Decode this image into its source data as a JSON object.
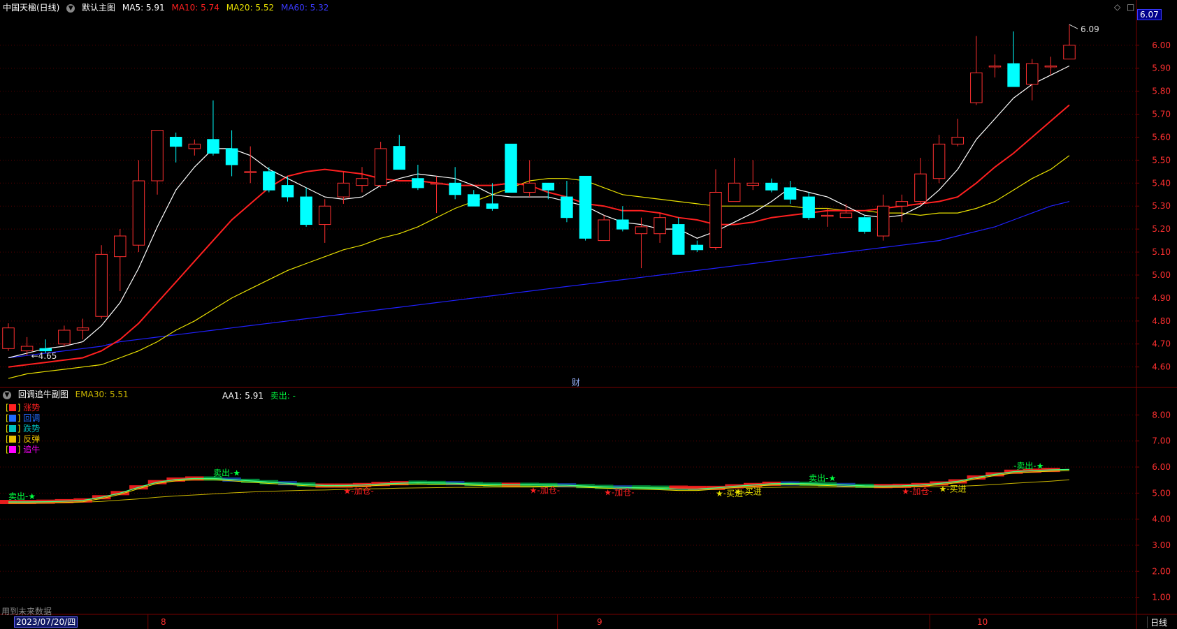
{
  "main_panel": {
    "stock_name": "中国天楹(日线)",
    "template": "默认主图",
    "ma_labels": [
      {
        "text": "MA5: 5.91",
        "color": "#ffffff"
      },
      {
        "text": "MA10: 5.74",
        "color": "#ff2020"
      },
      {
        "text": "MA20: 5.52",
        "color": "#e8e000"
      },
      {
        "text": "MA60: 5.32",
        "color": "#2020ff"
      }
    ],
    "current_price_tag": "6.07",
    "high_annotation": "6.09",
    "low_annotation": "4.65",
    "finance_marker": "财"
  },
  "sub_panel": {
    "title": "回调追牛副图",
    "ema_label": "EMA30: 5.51",
    "aa1_label": "AA1: 5.91",
    "sell_label": "卖出: -",
    "legend": [
      {
        "label": "涨势",
        "color": "#ff2020"
      },
      {
        "label": "回调",
        "color": "#1e6bff"
      },
      {
        "label": "跌势",
        "color": "#00c0c0"
      },
      {
        "label": "反弹",
        "color": "#e8c000"
      },
      {
        "label": "追牛",
        "color": "#ff00ff"
      }
    ],
    "signals": [
      {
        "text": "卖出-★",
        "color": "#00ff40",
        "idx": 0
      },
      {
        "text": "卖出-★",
        "color": "#00ff40",
        "idx": 11
      },
      {
        "text": "★-加仓-",
        "color": "#ff2020",
        "idx": 18
      },
      {
        "text": "★-加仓-",
        "color": "#ff2020",
        "idx": 28
      },
      {
        "text": "★-加仓-",
        "color": "#ff2020",
        "idx": 32
      },
      {
        "text": "★-买进-",
        "color": "#e8e000",
        "idx": 38
      },
      {
        "text": "★-买进",
        "color": "#e8e000",
        "idx": 39
      },
      {
        "text": "卖出-★",
        "color": "#00ff40",
        "idx": 43
      },
      {
        "text": "★-加仓-",
        "color": "#ff2020",
        "idx": 48
      },
      {
        "text": "★-买进",
        "color": "#e8e000",
        "idx": 50
      },
      {
        "text": "-卖出-★",
        "color": "#00ff40",
        "idx": 54
      }
    ]
  },
  "bottom_bar": {
    "future_data_note": "用到未来数据",
    "date_box": "2023/07/20/四",
    "month_labels": [
      "8",
      "9",
      "10"
    ],
    "period_button": "日线"
  },
  "icons": [
    "diamond-icon",
    "square-icon",
    "collapse-triangle-icon"
  ],
  "chart_data": [
    {
      "type": "candlestick",
      "title": "中国天楹(日线)",
      "y_axis_ticks": [
        4.6,
        4.7,
        4.8,
        4.9,
        5.0,
        5.1,
        5.2,
        5.3,
        5.4,
        5.5,
        5.6,
        5.7,
        5.8,
        5.9,
        6.0
      ],
      "ylim": [
        4.52,
        6.13
      ],
      "candles": [
        {
          "o": 4.68,
          "h": 4.79,
          "l": 4.67,
          "c": 4.77
        },
        {
          "o": 4.67,
          "h": 4.73,
          "l": 4.65,
          "c": 4.69
        },
        {
          "o": 4.68,
          "h": 4.72,
          "l": 4.66,
          "c": 4.67
        },
        {
          "o": 4.7,
          "h": 4.78,
          "l": 4.69,
          "c": 4.76
        },
        {
          "o": 4.76,
          "h": 4.81,
          "l": 4.72,
          "c": 4.77
        },
        {
          "o": 4.82,
          "h": 5.13,
          "l": 4.81,
          "c": 5.09
        },
        {
          "o": 5.08,
          "h": 5.2,
          "l": 4.93,
          "c": 5.17
        },
        {
          "o": 5.13,
          "h": 5.5,
          "l": 5.1,
          "c": 5.41
        },
        {
          "o": 5.41,
          "h": 5.63,
          "l": 5.35,
          "c": 5.63
        },
        {
          "o": 5.6,
          "h": 5.62,
          "l": 5.49,
          "c": 5.56
        },
        {
          "o": 5.55,
          "h": 5.59,
          "l": 5.52,
          "c": 5.57
        },
        {
          "o": 5.59,
          "h": 5.76,
          "l": 5.52,
          "c": 5.53
        },
        {
          "o": 5.55,
          "h": 5.63,
          "l": 5.43,
          "c": 5.48
        },
        {
          "o": 5.45,
          "h": 5.56,
          "l": 5.4,
          "c": 5.45
        },
        {
          "o": 5.45,
          "h": 5.47,
          "l": 5.36,
          "c": 5.37
        },
        {
          "o": 5.39,
          "h": 5.43,
          "l": 5.32,
          "c": 5.34
        },
        {
          "o": 5.34,
          "h": 5.38,
          "l": 5.21,
          "c": 5.22
        },
        {
          "o": 5.22,
          "h": 5.33,
          "l": 5.14,
          "c": 5.3
        },
        {
          "o": 5.34,
          "h": 5.45,
          "l": 5.31,
          "c": 5.4
        },
        {
          "o": 5.39,
          "h": 5.47,
          "l": 5.36,
          "c": 5.42
        },
        {
          "o": 5.39,
          "h": 5.58,
          "l": 5.38,
          "c": 5.55
        },
        {
          "o": 5.56,
          "h": 5.61,
          "l": 5.46,
          "c": 5.46
        },
        {
          "o": 5.42,
          "h": 5.48,
          "l": 5.37,
          "c": 5.38
        },
        {
          "o": 5.4,
          "h": 5.43,
          "l": 5.27,
          "c": 5.4
        },
        {
          "o": 5.4,
          "h": 5.47,
          "l": 5.33,
          "c": 5.35
        },
        {
          "o": 5.35,
          "h": 5.37,
          "l": 5.3,
          "c": 5.3
        },
        {
          "o": 5.31,
          "h": 5.4,
          "l": 5.28,
          "c": 5.29
        },
        {
          "o": 5.57,
          "h": 5.57,
          "l": 5.36,
          "c": 5.36
        },
        {
          "o": 5.36,
          "h": 5.5,
          "l": 5.34,
          "c": 5.4
        },
        {
          "o": 5.4,
          "h": 5.38,
          "l": 5.33,
          "c": 5.37
        },
        {
          "o": 5.34,
          "h": 5.41,
          "l": 5.23,
          "c": 5.25
        },
        {
          "o": 5.43,
          "h": 5.43,
          "l": 5.15,
          "c": 5.16
        },
        {
          "o": 5.15,
          "h": 5.26,
          "l": 5.15,
          "c": 5.24
        },
        {
          "o": 5.24,
          "h": 5.3,
          "l": 5.19,
          "c": 5.2
        },
        {
          "o": 5.18,
          "h": 5.25,
          "l": 5.03,
          "c": 5.21
        },
        {
          "o": 5.18,
          "h": 5.27,
          "l": 5.14,
          "c": 5.25
        },
        {
          "o": 5.22,
          "h": 5.25,
          "l": 5.09,
          "c": 5.09
        },
        {
          "o": 5.13,
          "h": 5.15,
          "l": 5.1,
          "c": 5.11
        },
        {
          "o": 5.12,
          "h": 5.46,
          "l": 5.11,
          "c": 5.36
        },
        {
          "o": 5.32,
          "h": 5.51,
          "l": 5.32,
          "c": 5.4
        },
        {
          "o": 5.39,
          "h": 5.5,
          "l": 5.37,
          "c": 5.4
        },
        {
          "o": 5.4,
          "h": 5.42,
          "l": 5.36,
          "c": 5.37
        },
        {
          "o": 5.38,
          "h": 5.41,
          "l": 5.31,
          "c": 5.33
        },
        {
          "o": 5.34,
          "h": 5.36,
          "l": 5.24,
          "c": 5.25
        },
        {
          "o": 5.26,
          "h": 5.29,
          "l": 5.21,
          "c": 5.26
        },
        {
          "o": 5.25,
          "h": 5.31,
          "l": 5.25,
          "c": 5.27
        },
        {
          "o": 5.25,
          "h": 5.26,
          "l": 5.18,
          "c": 5.19
        },
        {
          "o": 5.17,
          "h": 5.35,
          "l": 5.15,
          "c": 5.3
        },
        {
          "o": 5.3,
          "h": 5.35,
          "l": 5.23,
          "c": 5.32
        },
        {
          "o": 5.32,
          "h": 5.51,
          "l": 5.31,
          "c": 5.44
        },
        {
          "o": 5.42,
          "h": 5.61,
          "l": 5.4,
          "c": 5.57
        },
        {
          "o": 5.57,
          "h": 5.68,
          "l": 5.56,
          "c": 5.6
        },
        {
          "o": 5.75,
          "h": 6.04,
          "l": 5.74,
          "c": 5.88
        },
        {
          "o": 5.91,
          "h": 5.96,
          "l": 5.86,
          "c": 5.91
        },
        {
          "o": 5.92,
          "h": 6.06,
          "l": 5.82,
          "c": 5.82
        },
        {
          "o": 5.83,
          "h": 5.94,
          "l": 5.76,
          "c": 5.92
        },
        {
          "o": 5.91,
          "h": 5.95,
          "l": 5.87,
          "c": 5.91
        },
        {
          "o": 5.94,
          "h": 6.09,
          "l": 5.94,
          "c": 6.0
        }
      ],
      "ma5": [
        4.64,
        4.66,
        4.68,
        4.69,
        4.71,
        4.78,
        4.88,
        5.03,
        5.21,
        5.37,
        5.47,
        5.55,
        5.55,
        5.52,
        5.46,
        5.42,
        5.38,
        5.34,
        5.33,
        5.34,
        5.39,
        5.42,
        5.44,
        5.43,
        5.42,
        5.39,
        5.35,
        5.34,
        5.34,
        5.34,
        5.32,
        5.3,
        5.26,
        5.23,
        5.22,
        5.2,
        5.2,
        5.16,
        5.19,
        5.23,
        5.27,
        5.32,
        5.38,
        5.36,
        5.34,
        5.3,
        5.26,
        5.25,
        5.26,
        5.3,
        5.37,
        5.46,
        5.59,
        5.68,
        5.77,
        5.83,
        5.87,
        5.91
      ],
      "ma10": [
        4.6,
        4.61,
        4.62,
        4.63,
        4.64,
        4.67,
        4.72,
        4.79,
        4.88,
        4.97,
        5.06,
        5.15,
        5.24,
        5.31,
        5.38,
        5.43,
        5.45,
        5.46,
        5.45,
        5.44,
        5.42,
        5.41,
        5.41,
        5.4,
        5.39,
        5.39,
        5.39,
        5.4,
        5.39,
        5.36,
        5.34,
        5.31,
        5.3,
        5.28,
        5.28,
        5.27,
        5.25,
        5.24,
        5.22,
        5.22,
        5.23,
        5.25,
        5.26,
        5.27,
        5.28,
        5.28,
        5.28,
        5.29,
        5.3,
        5.31,
        5.32,
        5.34,
        5.4,
        5.47,
        5.53,
        5.6,
        5.67,
        5.74
      ],
      "ma20": [
        4.55,
        4.57,
        4.58,
        4.59,
        4.6,
        4.61,
        4.64,
        4.67,
        4.71,
        4.76,
        4.8,
        4.85,
        4.9,
        4.94,
        4.98,
        5.02,
        5.05,
        5.08,
        5.11,
        5.13,
        5.16,
        5.18,
        5.21,
        5.25,
        5.29,
        5.32,
        5.35,
        5.38,
        5.41,
        5.42,
        5.42,
        5.41,
        5.38,
        5.35,
        5.34,
        5.33,
        5.32,
        5.31,
        5.3,
        5.3,
        5.3,
        5.3,
        5.3,
        5.29,
        5.29,
        5.28,
        5.28,
        5.27,
        5.27,
        5.26,
        5.27,
        5.27,
        5.29,
        5.32,
        5.37,
        5.42,
        5.46,
        5.52
      ],
      "ma60": [
        4.64,
        4.65,
        4.66,
        4.67,
        4.68,
        4.69,
        4.71,
        4.72,
        4.73,
        4.74,
        4.75,
        4.76,
        4.77,
        4.78,
        4.79,
        4.8,
        4.81,
        4.82,
        4.83,
        4.84,
        4.85,
        4.86,
        4.87,
        4.88,
        4.89,
        4.9,
        4.91,
        4.92,
        4.93,
        4.94,
        4.95,
        4.96,
        4.97,
        4.98,
        4.99,
        5.0,
        5.01,
        5.02,
        5.03,
        5.04,
        5.05,
        5.06,
        5.07,
        5.08,
        5.09,
        5.1,
        5.11,
        5.12,
        5.13,
        5.14,
        5.15,
        5.17,
        5.19,
        5.21,
        5.24,
        5.27,
        5.3,
        5.32
      ]
    },
    {
      "type": "line",
      "title": "回调追牛副图",
      "y_axis_ticks": [
        1.0,
        2.0,
        3.0,
        4.0,
        5.0,
        6.0,
        7.0,
        8.0
      ],
      "ylim": [
        0.4,
        8.6
      ],
      "series": [
        {
          "name": "AA1",
          "values": [
            4.66,
            4.66,
            4.67,
            4.69,
            4.72,
            4.84,
            5.0,
            5.22,
            5.42,
            5.52,
            5.56,
            5.56,
            5.52,
            5.47,
            5.42,
            5.38,
            5.33,
            5.29,
            5.29,
            5.31,
            5.35,
            5.38,
            5.4,
            5.39,
            5.38,
            5.35,
            5.33,
            5.32,
            5.32,
            5.31,
            5.3,
            5.27,
            5.24,
            5.22,
            5.2,
            5.18,
            5.15,
            5.15,
            5.2,
            5.26,
            5.31,
            5.36,
            5.37,
            5.36,
            5.34,
            5.31,
            5.28,
            5.27,
            5.28,
            5.31,
            5.37,
            5.45,
            5.6,
            5.72,
            5.82,
            5.86,
            5.89,
            5.91
          ]
        },
        {
          "name": "EMA30",
          "values": [
            4.6,
            4.61,
            4.62,
            4.63,
            4.65,
            4.68,
            4.73,
            4.78,
            4.84,
            4.89,
            4.93,
            4.97,
            5.01,
            5.04,
            5.07,
            5.09,
            5.11,
            5.12,
            5.14,
            5.16,
            5.17,
            5.19,
            5.2,
            5.21,
            5.22,
            5.22,
            5.23,
            5.23,
            5.23,
            5.24,
            5.24,
            5.23,
            5.23,
            5.22,
            5.22,
            5.21,
            5.21,
            5.2,
            5.2,
            5.21,
            5.22,
            5.22,
            5.23,
            5.23,
            5.23,
            5.23,
            5.23,
            5.23,
            5.23,
            5.24,
            5.25,
            5.26,
            5.29,
            5.33,
            5.38,
            5.42,
            5.46,
            5.51
          ]
        }
      ]
    }
  ]
}
